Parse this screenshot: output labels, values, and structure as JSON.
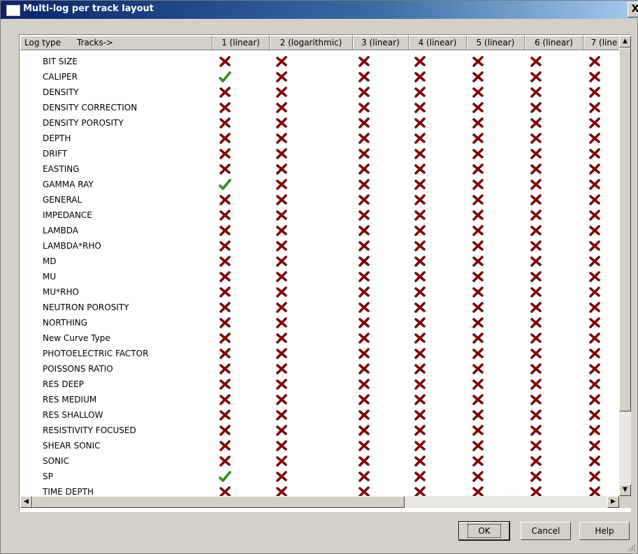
{
  "window": {
    "title": "Multi-log per track layout",
    "close_label": "X"
  },
  "header": {
    "first_col": "Log type      Tracks->",
    "tracks": [
      "1 (linear)",
      "2 (logarithmic)",
      "3 (linear)",
      "4 (linear)",
      "5 (linear)",
      "6 (linear)",
      "7 (line"
    ]
  },
  "rows": [
    {
      "label": "BIT SIZE",
      "checked": [
        0
      ]
    },
    {
      "label": "CALIPER",
      "checked": [
        1
      ]
    },
    {
      "label": "DENSITY",
      "checked": [
        0
      ]
    },
    {
      "label": "DENSITY CORRECTION",
      "checked": [
        0
      ]
    },
    {
      "label": "DENSITY POROSITY",
      "checked": [
        0
      ]
    },
    {
      "label": "DEPTH",
      "checked": [
        0
      ]
    },
    {
      "label": "DRIFT",
      "checked": [
        0
      ]
    },
    {
      "label": "EASTING",
      "checked": [
        0
      ]
    },
    {
      "label": "GAMMA RAY",
      "checked": [
        1
      ]
    },
    {
      "label": "GENERAL",
      "checked": [
        0
      ]
    },
    {
      "label": "IMPEDANCE",
      "checked": [
        0
      ]
    },
    {
      "label": "LAMBDA",
      "checked": [
        0
      ]
    },
    {
      "label": "LAMBDA*RHO",
      "checked": [
        0
      ]
    },
    {
      "label": "MD",
      "checked": [
        0
      ]
    },
    {
      "label": "MU",
      "checked": [
        0
      ]
    },
    {
      "label": "MU*RHO",
      "checked": [
        0
      ]
    },
    {
      "label": "NEUTRON POROSITY",
      "checked": [
        0
      ]
    },
    {
      "label": "NORTHING",
      "checked": [
        0
      ]
    },
    {
      "label": "New Curve Type",
      "checked": [
        0
      ]
    },
    {
      "label": "PHOTOELECTRIC FACTOR",
      "checked": [
        0
      ]
    },
    {
      "label": "POISSONS RATIO",
      "checked": [
        0
      ]
    },
    {
      "label": "RES DEEP",
      "checked": [
        0
      ]
    },
    {
      "label": "RES MEDIUM",
      "checked": [
        0
      ]
    },
    {
      "label": "RES SHALLOW",
      "checked": [
        0
      ]
    },
    {
      "label": "RESISTIVITY FOCUSED",
      "checked": [
        0
      ]
    },
    {
      "label": "SHEAR SONIC",
      "checked": [
        0
      ]
    },
    {
      "label": "SONIC",
      "checked": [
        0
      ]
    },
    {
      "label": "SP",
      "checked": [
        1
      ]
    },
    {
      "label": "TIME DEPTH",
      "checked": [
        0
      ]
    }
  ],
  "buttons": {
    "ok": "OK",
    "cancel": "Cancel",
    "help": "Help"
  },
  "colors": {
    "check": "#3a9a1a",
    "cross": "#8b0000"
  }
}
